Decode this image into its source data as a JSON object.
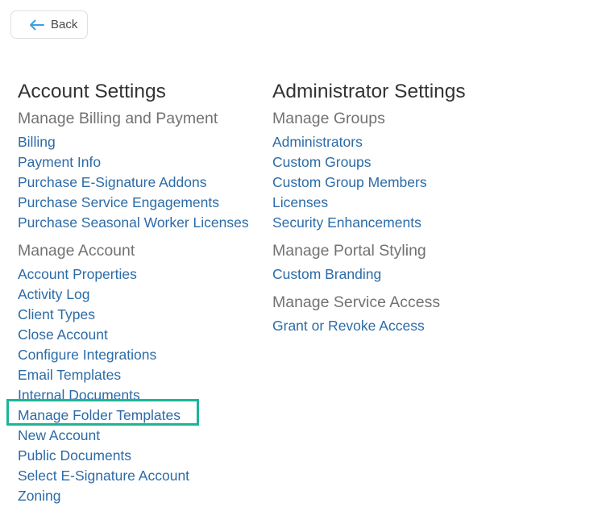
{
  "back_button": {
    "label": "Back",
    "icon": "arrow-left-icon",
    "icon_color": "#3a9fdf"
  },
  "account_settings": {
    "title": "Account Settings",
    "groups": [
      {
        "title": "Manage Billing and Payment",
        "links": [
          "Billing",
          "Payment Info",
          "Purchase E-Signature Addons",
          "Purchase Service Engagements",
          "Purchase Seasonal Worker Licenses"
        ]
      },
      {
        "title": "Manage Account",
        "links": [
          "Account Properties",
          "Activity Log",
          "Client Types",
          "Close Account",
          "Configure Integrations",
          "Email Templates",
          "Internal Documents",
          "Manage Folder Templates",
          "New Account",
          "Public Documents",
          "Select E-Signature Account",
          "Zoning"
        ]
      }
    ]
  },
  "administrator_settings": {
    "title": "Administrator Settings",
    "groups": [
      {
        "title": "Manage Groups",
        "links": [
          "Administrators",
          "Custom Groups",
          "Custom Group Members",
          "Licenses",
          "Security Enhancements"
        ]
      },
      {
        "title": "Manage Portal Styling",
        "links": [
          "Custom Branding"
        ]
      },
      {
        "title": "Manage Service Access",
        "links": [
          "Grant or Revoke Access"
        ]
      }
    ]
  },
  "highlighted_link": "Manage Folder Templates",
  "colors": {
    "link": "#2c6ba7",
    "heading": "#333333",
    "subheading": "#727272",
    "highlight_border": "#1bb597"
  }
}
